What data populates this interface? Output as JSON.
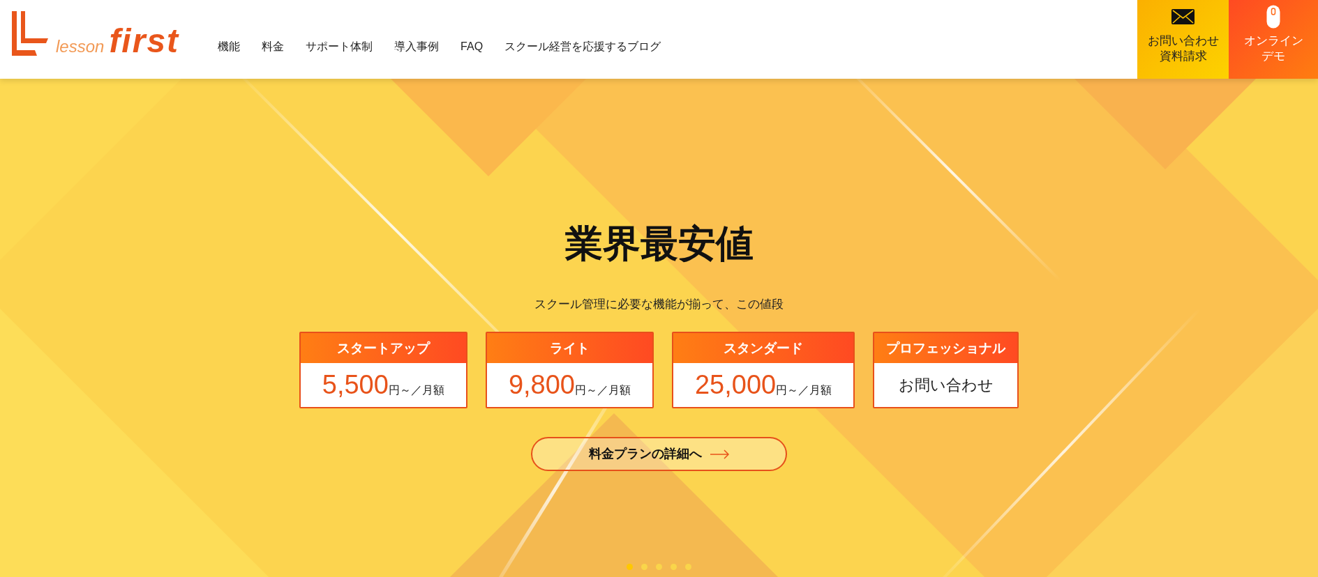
{
  "header": {
    "logo": {
      "prefix": "lesson",
      "name": "first"
    },
    "nav": [
      "機能",
      "料金",
      "サポート体制",
      "導入事例",
      "FAQ",
      "スクール経営を応援するブログ"
    ],
    "actions": [
      {
        "kind": "contact",
        "lines": [
          "お問い合わせ",
          "資料請求"
        ]
      },
      {
        "kind": "demo",
        "lines": [
          "オンライン",
          "デモ"
        ]
      }
    ]
  },
  "hero": {
    "title": "業界最安値",
    "subtitle": "スクール管理に必要な機能が揃って、この値段",
    "plans": [
      {
        "name": "スタートアップ",
        "kind": "price",
        "price": "5,500",
        "unit": "円～／月額"
      },
      {
        "name": "ライト",
        "kind": "price",
        "price": "9,800",
        "unit": "円～／月額"
      },
      {
        "name": "スタンダード",
        "kind": "price",
        "price": "25,000",
        "unit": "円～／月額"
      },
      {
        "name": "プロフェッショナル",
        "kind": "contact",
        "text": "お問い合わせ"
      }
    ],
    "cta": {
      "label": "料金プランの詳細へ"
    },
    "slides": [
      {
        "selected": true
      },
      {
        "selected": false
      },
      {
        "selected": false
      },
      {
        "selected": false
      },
      {
        "selected": false
      }
    ]
  }
}
